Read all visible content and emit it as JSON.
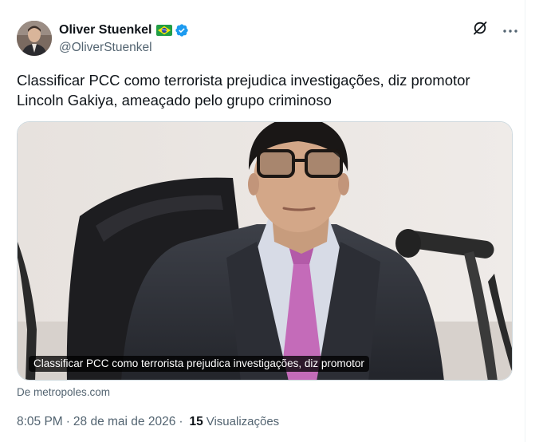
{
  "author": {
    "display_name": "Oliver Stuenkel",
    "handle": "@OliverStuenkel",
    "flag_icon": "brazil-flag-icon",
    "verified_icon": "verified-badge-icon",
    "verified_color": "#1d9bf0"
  },
  "actions": {
    "grok_icon": "grok-icon",
    "more_icon": "more-dots-icon"
  },
  "tweet": {
    "text": "Classificar PCC como terrorista prejudica investigações, diz promotor Lincoln Gakiya, ameaçado pelo grupo criminoso"
  },
  "card": {
    "caption": "Classificar PCC como terrorista prejudica investigações, diz promotor",
    "source": "De metropoles.com"
  },
  "meta": {
    "time": "8:05 PM",
    "separator": "·",
    "date": "28 de mai de 2026",
    "views_count": "15",
    "views_label": "Visualizações"
  },
  "colors": {
    "text": "#0f1419",
    "secondary": "#536471",
    "accent": "#1d9bf0"
  }
}
